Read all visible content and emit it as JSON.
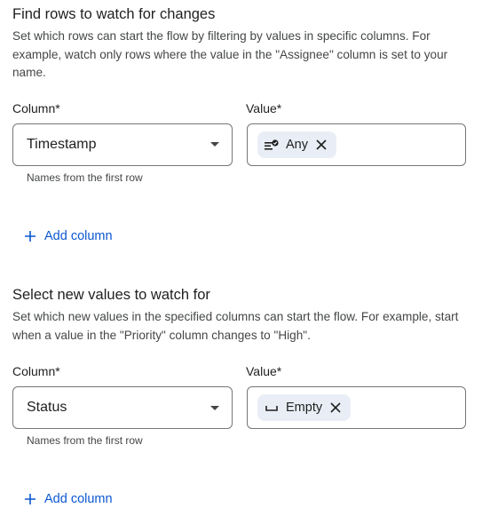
{
  "watch_rows": {
    "title": "Find rows to watch for changes",
    "description": "Set which rows can start the flow by filtering by values in specific columns. For example, watch only rows where the value in the \"Assignee\" column is set to your name.",
    "column_label": "Column*",
    "value_label": "Value*",
    "column_value": "Timestamp",
    "chip_label": "Any",
    "chip_icon": "filter-any-icon",
    "helper": "Names from the first row",
    "add_label": "Add column"
  },
  "watch_values": {
    "title": "Select new values to watch for",
    "description": "Set which new values in the specified columns can start the flow. For example, start when a value in the \"Priority\" column changes to \"High\".",
    "column_label": "Column*",
    "value_label": "Value*",
    "column_value": "Status",
    "chip_label": "Empty",
    "chip_icon": "space-bar-icon",
    "helper": "Names from the first row",
    "add_label": "Add column"
  },
  "colors": {
    "accent": "#0b57d0",
    "chip_bg": "#e9eef6",
    "border": "#747775"
  }
}
